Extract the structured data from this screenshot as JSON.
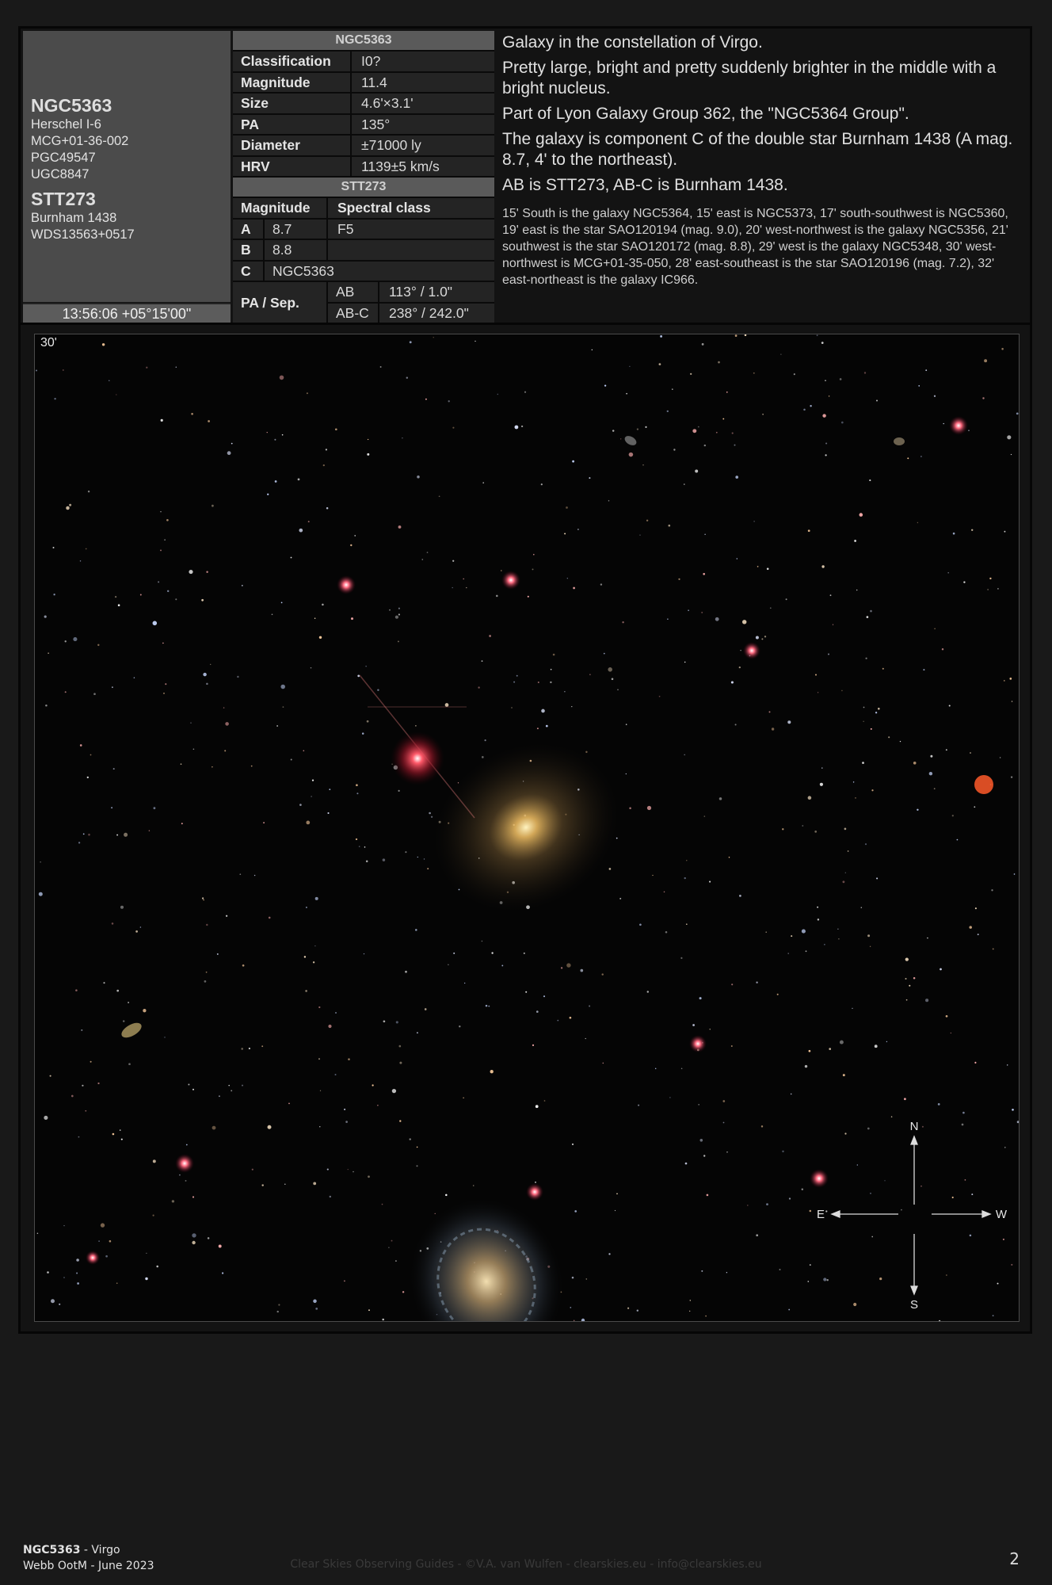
{
  "identity": {
    "primary_name": "NGC5363",
    "primary_designations": [
      "Herschel I-6",
      "MCG+01-36-002",
      "PGC49547",
      "UGC8847"
    ],
    "secondary_name": "STT273",
    "secondary_designations": [
      "Burnham 1438",
      "WDS13563+0517"
    ],
    "coordinates": "13:56:06 +05°15'00\""
  },
  "galaxy_table": {
    "header": "NGC5363",
    "rows": [
      {
        "key": "Classification",
        "value": "I0?"
      },
      {
        "key": "Magnitude",
        "value": "11.4"
      },
      {
        "key": "Size",
        "value": "4.6'×3.1'"
      },
      {
        "key": "PA",
        "value": "135°"
      },
      {
        "key": "Diameter",
        "value": "±71000 ly"
      },
      {
        "key": "HRV",
        "value": "1139±5 km/s"
      }
    ]
  },
  "star_table": {
    "header": "STT273",
    "col_magnitude": "Magnitude",
    "col_spectral": "Spectral class",
    "components": [
      {
        "id": "A",
        "mag": "8.7",
        "spec": "F5"
      },
      {
        "id": "B",
        "mag": "8.8",
        "spec": ""
      },
      {
        "id": "C",
        "text": "NGC5363"
      }
    ],
    "pasep_label": "PA / Sep.",
    "pasep": [
      {
        "pair": "AB",
        "value": "113° / 1.0\""
      },
      {
        "pair": "AB-C",
        "value": "238° / 242.0\""
      }
    ]
  },
  "description": {
    "lines": [
      "Galaxy in the constellation of Virgo.",
      "Pretty large, bright and pretty suddenly brighter in the middle with a bright nucleus.",
      "Part of Lyon Galaxy Group 362, the \"NGC5364 Group\".",
      "The galaxy is component C of the double star Burnham 1438 (A mag. 8.7, 4' to the northeast).",
      "AB is STT273, AB-C is Burnham 1438."
    ],
    "surroundings": "15' South is the galaxy NGC5364, 15' east is NGC5373, 17' south-southwest is NGC5360, 19' east is the star SAO120194 (mag. 9.0), 20' west-northwest is the galaxy NGC5356, 21' southwest is the star SAO120172 (mag. 8.8), 29' west is the galaxy NGC5348, 30' west-northwest is MCG+01-35-050, 28' east-southeast is the star SAO120196 (mag. 7.2), 32' east-northeast is the galaxy IC966."
  },
  "image": {
    "fov_label": "30'",
    "compass": {
      "n": "N",
      "s": "S",
      "e": "E",
      "w": "W"
    }
  },
  "footer": {
    "object": "NGC5363",
    "constellation_suffix": " - Virgo",
    "edition": "Webb OotM - June 2023",
    "credit": "Clear Skies Observing Guides - ©V.A. van Wulfen - clearskies.eu - info@clearskies.eu",
    "page": "2"
  }
}
